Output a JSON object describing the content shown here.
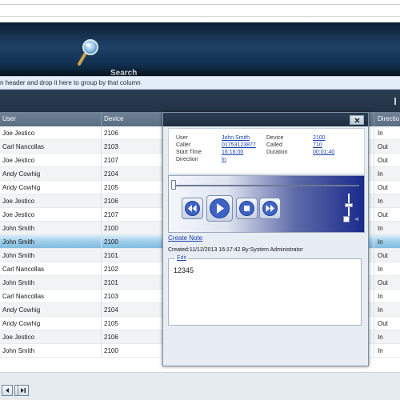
{
  "header": {
    "search_label": "Search"
  },
  "group_panel": {
    "text": "n header and drop it here to group by that column"
  },
  "grid": {
    "columns": {
      "user": "User",
      "device": "Device",
      "direction": "Directio"
    },
    "rows": [
      {
        "user": "Joe Jestico",
        "device": "2106",
        "direction": "In"
      },
      {
        "user": "Carl Nancollas",
        "device": "2103",
        "direction": "Out"
      },
      {
        "user": "Joe Jestico",
        "device": "2107",
        "direction": "Out"
      },
      {
        "user": "Andy Cowhig",
        "device": "2104",
        "direction": "In"
      },
      {
        "user": "Andy Cowhig",
        "device": "2105",
        "direction": "Out"
      },
      {
        "user": "Joe Jestico",
        "device": "2106",
        "direction": "In"
      },
      {
        "user": "Joe Jestico",
        "device": "2107",
        "direction": "Out"
      },
      {
        "user": "John Smith",
        "device": "2100",
        "direction": "In"
      },
      {
        "user": "John Smith",
        "device": "2100",
        "direction": "In",
        "selected": true
      },
      {
        "user": "John Smith",
        "device": "2101",
        "direction": "Out"
      },
      {
        "user": "Carl Nancollas",
        "device": "2102",
        "direction": "In"
      },
      {
        "user": "John Smith",
        "device": "2101",
        "direction": "Out"
      },
      {
        "user": "Carl Nancollas",
        "device": "2103",
        "direction": "In"
      },
      {
        "user": "Andy Cowhig",
        "device": "2104",
        "direction": "In"
      },
      {
        "user": "Andy Cowhig",
        "device": "2105",
        "direction": "Out"
      },
      {
        "user": "Joe Jestico",
        "device": "2106",
        "direction": "In"
      },
      {
        "user": "John Smith",
        "device": "2100",
        "direction": "In"
      }
    ]
  },
  "dialog": {
    "close_icon": "close-icon",
    "info": {
      "user_label": "User",
      "user_value": "John Smith",
      "caller_label": "Caller",
      "caller_value": "01753123877",
      "start_time_label": "Start Time",
      "start_time_value": "16:16:00",
      "direction_label": "Direction",
      "direction_value": "In",
      "device_label": "Device",
      "device_value": "2100",
      "called_label": "Called",
      "called_value": "710",
      "duration_label": "Duration",
      "duration_value": "00:01:40"
    },
    "player": {
      "buttons": [
        "rewind-icon",
        "play-icon",
        "stop-icon",
        "fast-forward-icon"
      ],
      "volume_icon": "speaker-icon",
      "accent": "#1a2a8c"
    },
    "create_note_label": "Create Note",
    "note_meta": "Created:11/12/2013 16:17:42 By:System Administrator",
    "edit_label": "Edit",
    "note_text": "12345"
  },
  "colors": {
    "header_bg": "#1d4165",
    "selected_row": "#9fcde9",
    "link": "#1a3fb0"
  }
}
